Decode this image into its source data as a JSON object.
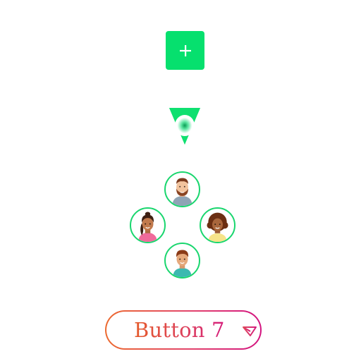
{
  "add_button": {
    "icon": "plus-icon",
    "color": "#06e06e"
  },
  "pointer": {
    "icon": "navigation-arrow-icon",
    "color": "#0fe070"
  },
  "avatar_group": {
    "ring_color": "#19d66e",
    "avatars": [
      {
        "position": "top",
        "icon": "bearded-man-avatar-icon"
      },
      {
        "position": "left",
        "icon": "woman-ponytail-avatar-icon"
      },
      {
        "position": "right",
        "icon": "curly-hair-woman-avatar-icon"
      },
      {
        "position": "bottom",
        "icon": "boy-avatar-icon"
      }
    ]
  },
  "gradient_button": {
    "label": "Button 7",
    "icon": "triangle-down-icon",
    "gradient_start": "#ec6a2f",
    "gradient_end": "#d3137f"
  }
}
